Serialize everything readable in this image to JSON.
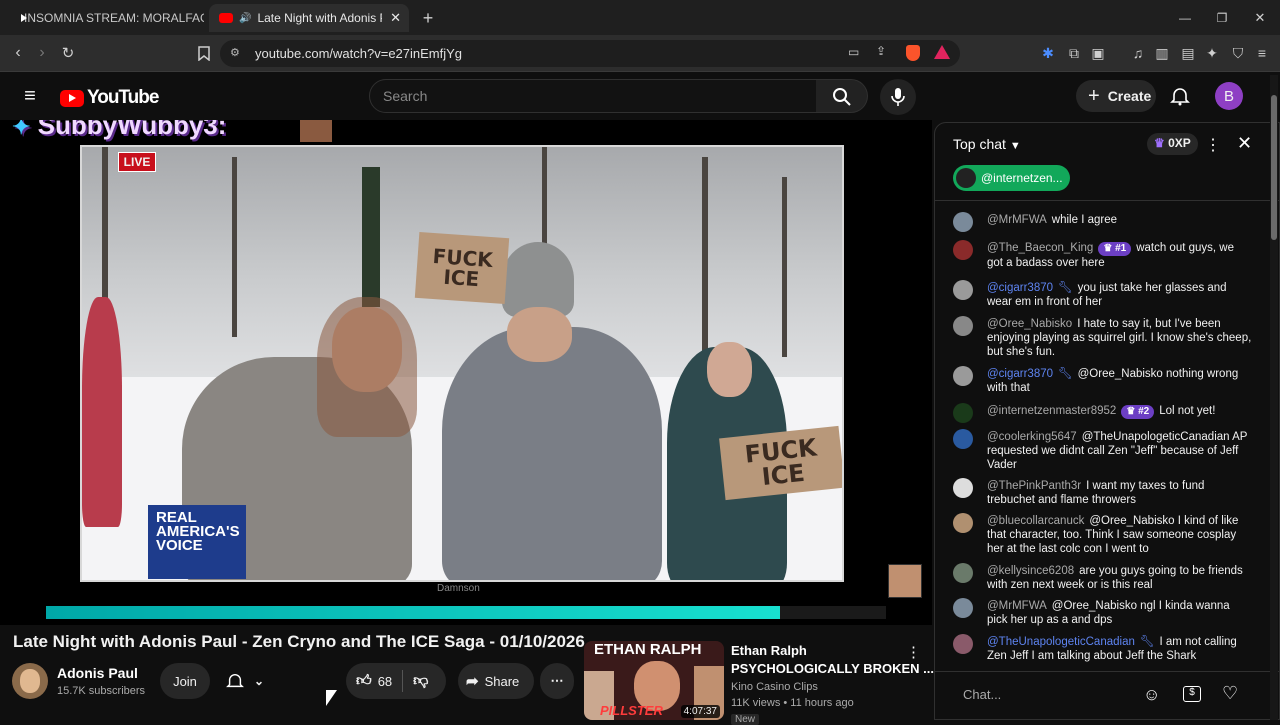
{
  "browser": {
    "tabs": [
      {
        "label": "INSOMNIA STREAM: MORALFAG EDI",
        "active": false
      },
      {
        "label": "Late Night with Adonis Paul -",
        "active": true
      }
    ],
    "url": "youtube.com/watch?v=e27inEmfjYg"
  },
  "header": {
    "logo_text": "YouTube",
    "search_placeholder": "Search",
    "create_label": "Create",
    "avatar_letter": "B"
  },
  "player": {
    "overlay_name": "SubbyWubby3:",
    "live_badge": "LIVE",
    "network_logo": "REAL AMERICA'S VOICE",
    "sign_text_1": "FUCK ICE",
    "sign_text_2": "FUCK ICE",
    "watermark": "Damnson"
  },
  "video": {
    "title": "Late Night with Adonis Paul - Zen Cryno and The ICE Saga - 01/10/2026",
    "channel_name": "Adonis Paul",
    "subscribers": "15.7K subscribers",
    "join_label": "Join",
    "likes": "68",
    "share_label": "Share"
  },
  "recommended": {
    "thumb_text": "ETHAN RALPH",
    "thumb_sub": "PILLSTER",
    "duration": "4:07:37",
    "channel_line": "Ethan Ralph",
    "title": "PSYCHOLOGICALLY BROKEN ...",
    "channel": "Kino Casino Clips",
    "meta": "11K views • 11 hours ago",
    "badge": "New"
  },
  "chat": {
    "header": "Top chat",
    "xp": "0XP",
    "pinned_user": "@internetzen...",
    "input_placeholder": "Chat...",
    "messages": [
      {
        "user": "@MrMFWA",
        "badge": "",
        "mod": false,
        "text": "while I agree"
      },
      {
        "user": "@The_Baecon_King",
        "badge": "#1",
        "mod": false,
        "text": "watch out guys, we got a badass over here"
      },
      {
        "user": "@cigarr3870",
        "badge": "",
        "mod": true,
        "text": "you just take her glasses and wear em in front of her"
      },
      {
        "user": "@Oree_Nabisko",
        "badge": "",
        "mod": false,
        "text": "I hate to say it, but I've been enjoying playing as squirrel girl. I know she's cheep, but she's fun."
      },
      {
        "user": "@cigarr3870",
        "badge": "",
        "mod": true,
        "text": "@Oree_Nabisko nothing wrong with that"
      },
      {
        "user": "@internetzenmaster8952",
        "badge": "#2",
        "mod": false,
        "text": "Lol not yet!"
      },
      {
        "user": "@coolerking5647",
        "badge": "",
        "mod": false,
        "text": "@TheUnapologeticCanadian AP requested we didnt call Zen \"Jeff\" because of Jeff Vader"
      },
      {
        "user": "@ThePinkPanth3r",
        "badge": "",
        "mod": false,
        "text": "I want my taxes to fund trebuchet and flame throwers"
      },
      {
        "user": "@bluecollarcanuck",
        "badge": "",
        "mod": false,
        "text": "@Oree_Nabisko I kind of like that character, too. Think I saw someone cosplay her at the last colc con I went to"
      },
      {
        "user": "@kellysince6208",
        "badge": "",
        "mod": false,
        "text": "are you guys going to be friends with zen next week or is this real"
      },
      {
        "user": "@MrMFWA",
        "badge": "",
        "mod": false,
        "text": "@Oree_Nabisko ngl I kinda wanna pick her up as a and dps"
      },
      {
        "user": "@TheUnapologeticCanadian",
        "badge": "",
        "mod": true,
        "text": "I am not calling Zen Jeff I am talking about Jeff the Shark"
      }
    ]
  },
  "colors": {
    "accent": "#ff0000",
    "chat_badge": "#6c3fc4",
    "mod_blue": "#5e84f1",
    "progress": "#18e0d0"
  }
}
